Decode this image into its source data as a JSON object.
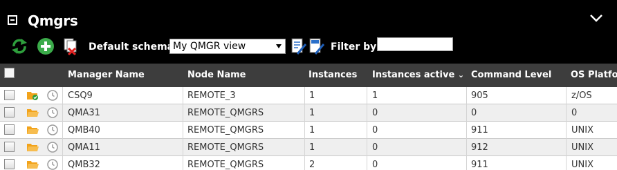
{
  "panel": {
    "title": "Qmgrs"
  },
  "toolbar": {
    "schema_label": "Default schema:",
    "schema_value": "My QMGR view",
    "filter_label": "Filter by:",
    "filter_value": ""
  },
  "columns": [
    "Manager Name",
    "Node Name",
    "Instances",
    "Instances active",
    "Command Level",
    "OS Platfor"
  ],
  "sort_indicator": "⌄",
  "rows": [
    {
      "manager": "CSQ9",
      "node": "REMOTE_3",
      "instances": "1",
      "active": "1",
      "command_level": "905",
      "platform": "z/OS",
      "status_icon": "folder-check-icon"
    },
    {
      "manager": "QMA31",
      "node": "REMOTE_QMGRS",
      "instances": "1",
      "active": "0",
      "command_level": "0",
      "platform": "0",
      "status_icon": "folder-icon"
    },
    {
      "manager": "QMB40",
      "node": "REMOTE_QMGRS",
      "instances": "1",
      "active": "0",
      "command_level": "911",
      "platform": "UNIX",
      "status_icon": "folder-icon"
    },
    {
      "manager": "QMA11",
      "node": "REMOTE_QMGRS",
      "instances": "1",
      "active": "0",
      "command_level": "912",
      "platform": "UNIX",
      "status_icon": "folder-icon"
    },
    {
      "manager": "QMB32",
      "node": "REMOTE_QMGRS",
      "instances": "2",
      "active": "0",
      "command_level": "911",
      "platform": "UNIX",
      "status_icon": "folder-icon"
    }
  ],
  "colors": {
    "header_bg": "#000000",
    "grid_header_bg": "#3d3d3d",
    "refresh_green": "#2e9e3c",
    "add_green": "#3bab4a",
    "folder_orange": "#f2a31b"
  }
}
